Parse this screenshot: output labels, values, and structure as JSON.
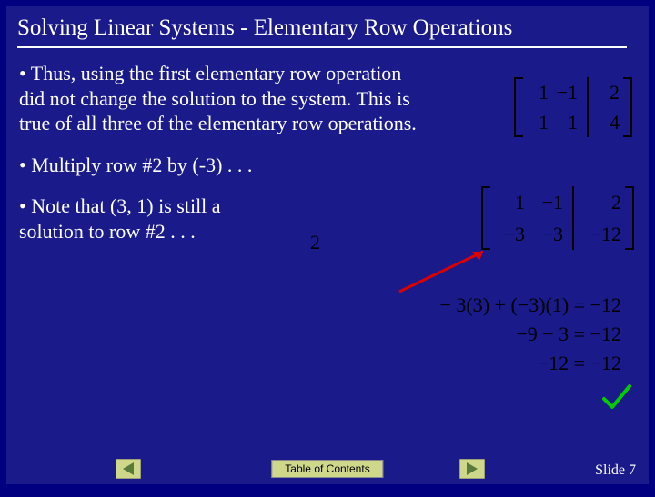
{
  "title": "Solving Linear Systems - Elementary Row Operations",
  "bullets": {
    "b1": "•  Thus, using the first elementary row operation did not change the solution to the system.  This is true of all three of the elementary row operations.",
    "b2": "•  Multiply row #2 by (-3) . . .",
    "b3": "•  Note that (3, 1) is still a solution to row #2 . . ."
  },
  "matrix1": {
    "c1": [
      "1",
      "1"
    ],
    "c2": [
      "−1",
      "1"
    ],
    "aug": [
      "2",
      "4"
    ]
  },
  "matrix2": {
    "c1": [
      "1",
      "−3"
    ],
    "c2": [
      "−1",
      "−3"
    ],
    "aug": [
      "2",
      "−12"
    ]
  },
  "equations": {
    "e1": "− 3(3) + (−3)(1) = −12",
    "e2": "−9 − 3 = −12",
    "e3": "−12 = −12"
  },
  "two_label": "2",
  "footer": {
    "toc": "Table of Contents",
    "slide": "Slide 7"
  }
}
